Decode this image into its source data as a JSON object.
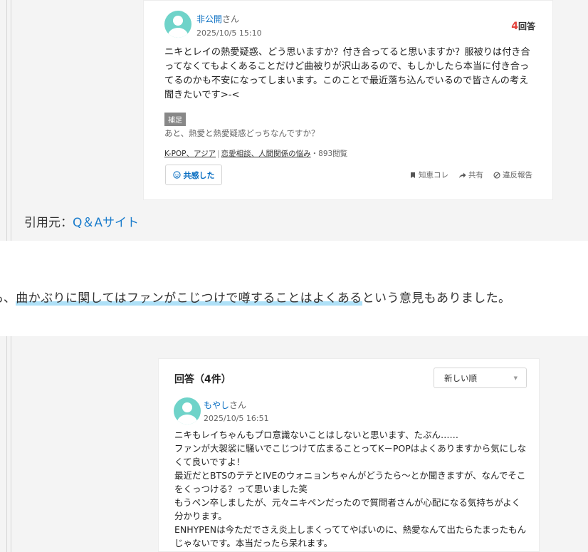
{
  "question": {
    "user": "非公開",
    "honorific": "さん",
    "date": "2025/10/5 15:10",
    "answer_count": "4",
    "answer_suffix": "回答",
    "body": "ニキとレイの熱愛疑惑、どう思いますか？付き合ってると思いますか？服被りは付き合ってなくてもよくあることだけど曲被りが沢山あるので、もしかしたら本当に付き合ってるのかも不安になってしまいます。このことで最近落ち込んでいるので皆さんの考え聞きたいです>-<",
    "supplement_label": "補足",
    "supplement": "あと、熱愛と熱愛疑惑どっちなんですか？",
    "category_1": "K-POP、アジア",
    "category_2": "恋愛相談、人間関係の悩み",
    "views": "・893閲覧",
    "empathy_button": "共感した",
    "actions": {
      "chiebukuro": "知恵コレ",
      "share": "共有",
      "report": "違反報告"
    }
  },
  "source": {
    "label": "引用元：",
    "link": "Q＆Aサイト"
  },
  "body_line": {
    "prefix": "も、",
    "highlight": "曲かぶりに関してはファンがこじつけで噂することはよくある",
    "suffix": "という意見もありました。"
  },
  "answers": {
    "title": "回答（4件）",
    "sort_selected": "新しい順",
    "first": {
      "user": "もやし",
      "honorific": "さん",
      "date": "2025/10/5 16:51",
      "body": "ニキもレイちゃんもプロ意識ないことはしないと思います、たぶん……\nファンが大袈裟に騒いでこじつけて広まることってK－POPはよくありますから気にしなくて良いですよ！\n最近だとBTSのテテとIVEのウォニョンちゃんがどうたら～とか聞きますが、なんでそこをくっつける？って思いました笑\nもうペン卒しましたが、元々ニキペンだったので質問者さんが心配になる気持ちがよく分かります。\nENHYPENは今ただでさえ炎上しまくっててやばいのに、熱愛なんて出たらたまったもんじゃないです。本当だったら呆れます。"
    }
  },
  "colors": {
    "link": "#0a6fc2",
    "accent_red": "#e4433c",
    "avatar": "#6fd3c9",
    "highlight": "#aee0f7"
  }
}
